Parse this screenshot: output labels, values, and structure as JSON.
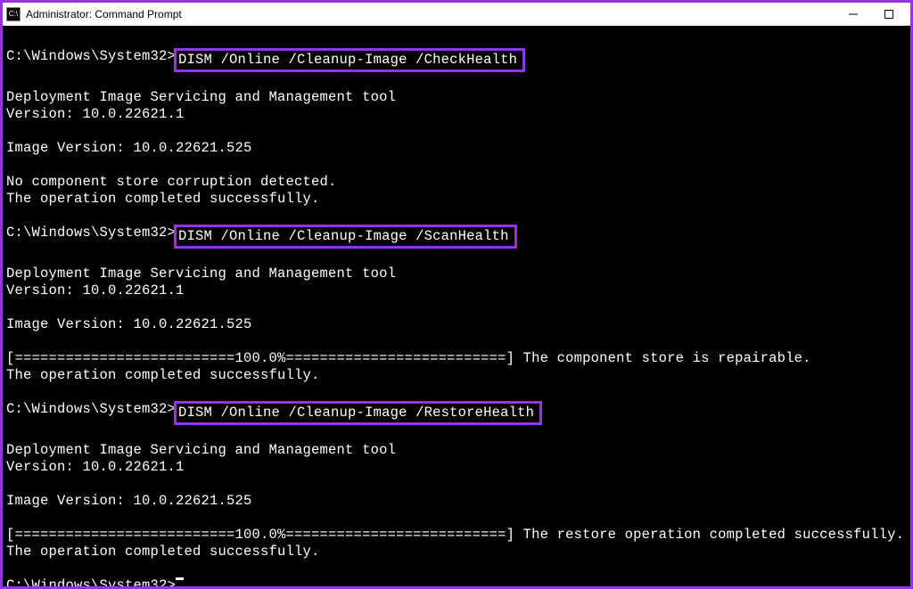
{
  "titlebar": {
    "icon_text": "C:\\",
    "title": "Administrator: Command Prompt"
  },
  "terminal": {
    "prompt": "C:\\Windows\\System32>",
    "cmd1": "DISM /Online /Cleanup-Image /CheckHealth",
    "cmd2": "DISM /Online /Cleanup-Image /ScanHealth",
    "cmd3": "DISM /Online /Cleanup-Image /RestoreHealth",
    "out_tool": "Deployment Image Servicing and Management tool",
    "out_version": "Version: 10.0.22621.1",
    "out_image_version": "Image Version: 10.0.22621.525",
    "out_no_corruption": "No component store corruption detected.",
    "out_completed": "The operation completed successfully.",
    "out_progress_repairable": "[==========================100.0%==========================] The component store is repairable.",
    "out_progress_restore": "[==========================100.0%==========================] The restore operation completed successfully.",
    "blank": ""
  }
}
